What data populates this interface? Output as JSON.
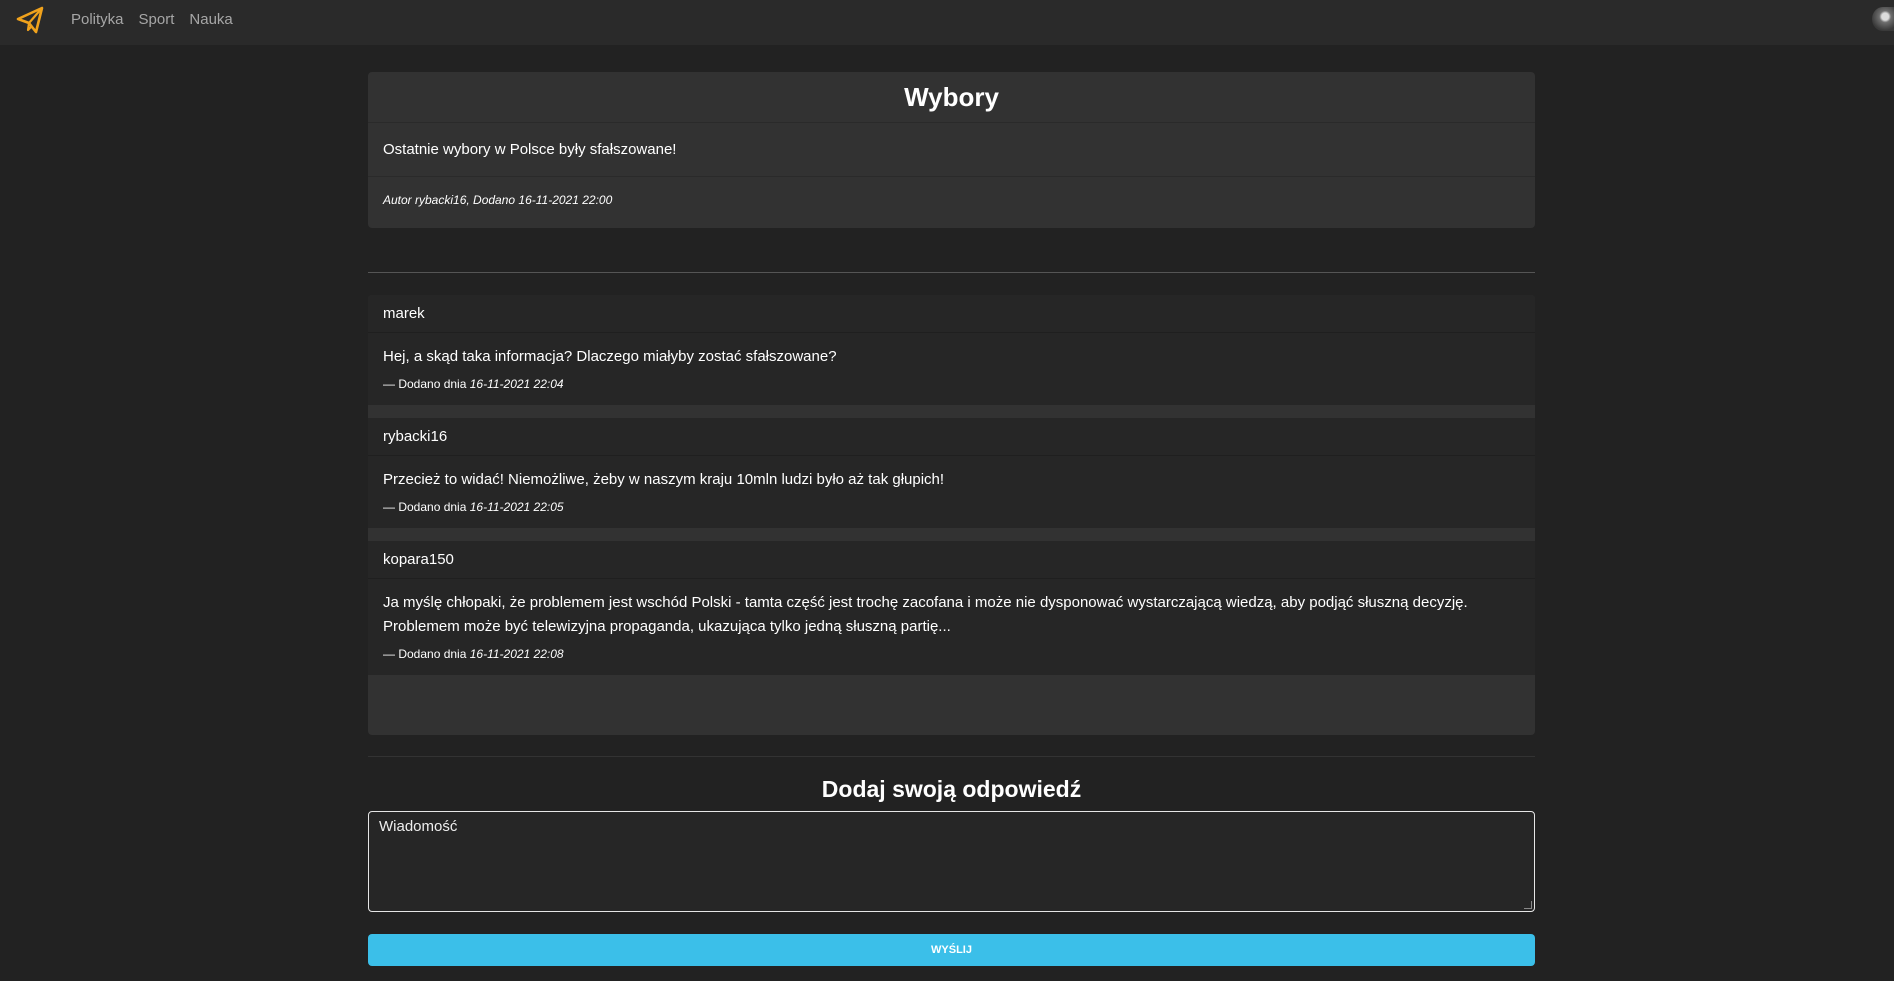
{
  "nav": {
    "links": [
      "Polityka",
      "Sport",
      "Nauka"
    ]
  },
  "icons": {
    "brand": "paper-plane-icon",
    "avatar": "user-avatar"
  },
  "colors": {
    "accent": "#f0a21c",
    "button": "#3bbfe9"
  },
  "post": {
    "title": "Wybory",
    "body": "Ostatnie wybory w Polsce były sfałszowane!",
    "meta": "Autor rybacki16, Dodano 16-11-2021 22:00"
  },
  "comments": [
    {
      "author": "marek",
      "body": "Hej, a skąd taka informacja? Dlaczego miałyby zostać sfałszowane?",
      "prefix": "— Dodano dnia",
      "date": "16-11-2021 22:04"
    },
    {
      "author": "rybacki16",
      "body": "Przecież to widać! Niemożliwe, żeby w naszym kraju 10mln ludzi było aż tak głupich!",
      "prefix": "— Dodano dnia",
      "date": "16-11-2021 22:05"
    },
    {
      "author": "kopara150",
      "body": "Ja myślę chłopaki, że problemem jest wschód Polski - tamta część jest trochę zacofana i może nie dysponować wystarczającą wiedzą, aby podjąć słuszną decyzję. Problemem może być telewizyjna propaganda, ukazująca tylko jedną słuszną partię...",
      "prefix": "— Dodano dnia",
      "date": "16-11-2021 22:08"
    }
  ],
  "reply": {
    "title": "Dodaj swoją odpowiedź",
    "placeholder": "Wiadomość",
    "button": "WYŚLIJ"
  }
}
